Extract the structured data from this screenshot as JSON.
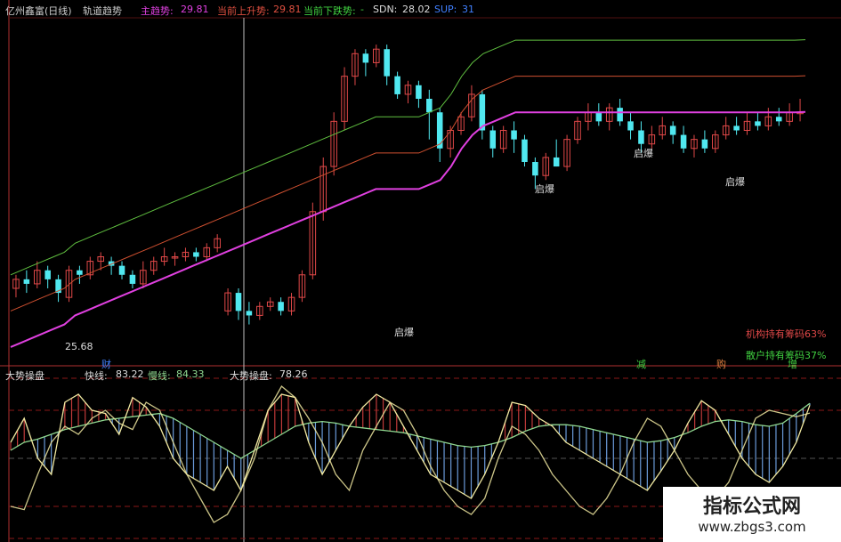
{
  "header": {
    "title": "亿州鑫富(日线)",
    "indicator": "轨道趋势",
    "main_label": "主趋势:",
    "main_value": "29.81",
    "up_label": "当前上升势:",
    "up_value": "29.81",
    "down_label": "当前下跌势:",
    "down_value": "-",
    "sdn_label": "SDN:",
    "sdn_value": "28.02",
    "sup_label": "SUP:",
    "sup_value": "31"
  },
  "upper_panel": {
    "low_marker": "25.68",
    "signal_label": "启爆",
    "inst_chips": "机构持有筹码63%",
    "retail_chips": "散户持有筹码37%",
    "tag_cai": "财",
    "tag_jian": "减",
    "tag_gou": "购",
    "tag_zeng": "增"
  },
  "lower_panel": {
    "title": "大势操盘",
    "fast_label": "快线:",
    "fast_value": "83.22",
    "slow_label": "慢线:",
    "slow_value": "84.33",
    "trend_label": "大势操盘:",
    "trend_value": "78.26"
  },
  "watermark": {
    "line1": "指标公式网",
    "line2": "www.zbgs3.com"
  },
  "colors": {
    "up_candle": "#e04848",
    "down_candle": "#50e8f0",
    "signal_candle": "#40e040",
    "main_trend": "#e040e0",
    "upper_trend": "#d05030",
    "lower_trend": "#60c040",
    "slow_line": "#90d890",
    "fast_line": "#f0e8a0"
  },
  "chart_data": [
    {
      "type": "candlestick",
      "title": "亿州鑫富(日线)",
      "series": [
        {
          "name": "主趋势",
          "color": "#e040e0",
          "values": [
            24.6,
            24.7,
            24.8,
            24.9,
            25.0,
            25.1,
            25.3,
            25.4,
            25.5,
            25.6,
            25.7,
            25.8,
            25.9,
            26.0,
            26.1,
            26.2,
            26.3,
            26.4,
            26.5,
            26.6,
            26.7,
            26.8,
            26.9,
            27.0,
            27.1,
            27.2,
            27.3,
            27.4,
            27.5,
            27.6,
            27.7,
            27.8,
            27.9,
            28.0,
            28.1,
            28.1,
            28.1,
            28.1,
            28.1,
            28.2,
            28.3,
            28.6,
            29.0,
            29.3,
            29.5,
            29.6,
            29.7,
            29.8,
            29.8,
            29.8,
            29.8,
            29.8,
            29.8,
            29.8,
            29.8,
            29.8,
            29.8,
            29.8,
            29.8,
            29.8,
            29.8,
            29.8,
            29.8,
            29.8,
            29.8,
            29.8,
            29.8,
            29.8,
            29.8,
            29.8,
            29.8,
            29.8,
            29.8,
            29.8,
            29.81
          ]
        }
      ],
      "candles": [
        [
          25.9,
          26.1,
          25.7,
          26.2
        ],
        [
          26.1,
          26.0,
          25.8,
          26.3
        ],
        [
          26.0,
          26.3,
          25.9,
          26.5
        ],
        [
          26.3,
          26.1,
          25.9,
          26.4
        ],
        [
          26.1,
          25.8,
          25.6,
          26.2
        ],
        [
          25.7,
          26.3,
          25.6,
          26.4
        ],
        [
          26.3,
          26.2,
          26.0,
          26.4
        ],
        [
          26.2,
          26.5,
          26.1,
          26.6
        ],
        [
          26.5,
          26.6,
          26.3,
          26.7
        ],
        [
          26.5,
          26.4,
          26.2,
          26.6
        ],
        [
          26.4,
          26.2,
          26.1,
          26.5
        ],
        [
          26.2,
          26.0,
          25.9,
          26.3
        ],
        [
          26.0,
          26.3,
          25.9,
          26.5
        ],
        [
          26.3,
          26.5,
          26.2,
          26.6
        ],
        [
          26.5,
          26.6,
          26.4,
          26.8
        ],
        [
          26.6,
          26.6,
          26.4,
          26.7
        ],
        [
          26.6,
          26.7,
          26.5,
          26.8
        ],
        [
          26.7,
          26.6,
          26.5,
          26.8
        ],
        [
          26.6,
          26.8,
          26.5,
          26.9
        ],
        [
          26.8,
          27.0,
          26.7,
          27.1
        ],
        [
          25.4,
          25.8,
          25.3,
          25.9
        ],
        [
          25.8,
          25.4,
          25.2,
          25.9
        ],
        [
          25.4,
          25.3,
          25.1,
          25.6
        ],
        [
          25.3,
          25.5,
          25.2,
          25.6
        ],
        [
          25.5,
          25.6,
          25.4,
          25.7
        ],
        [
          25.6,
          25.4,
          25.3,
          25.7
        ],
        [
          25.4,
          25.7,
          25.3,
          25.8
        ],
        [
          25.7,
          26.2,
          25.6,
          26.3
        ],
        [
          26.2,
          27.6,
          26.1,
          27.8
        ],
        [
          27.6,
          28.6,
          27.4,
          28.8
        ],
        [
          28.6,
          29.6,
          28.4,
          29.8
        ],
        [
          29.6,
          30.6,
          29.4,
          30.8
        ],
        [
          30.6,
          31.1,
          30.4,
          31.2
        ],
        [
          31.1,
          30.9,
          30.6,
          31.2
        ],
        [
          30.9,
          31.2,
          30.8,
          31.3
        ],
        [
          31.2,
          30.6,
          30.4,
          31.3
        ],
        [
          30.6,
          30.2,
          30.1,
          30.7
        ],
        [
          30.2,
          30.4,
          30.0,
          30.5
        ],
        [
          30.4,
          30.1,
          29.9,
          30.5
        ],
        [
          30.1,
          29.8,
          29.2,
          30.3
        ],
        [
          29.8,
          29.0,
          28.7,
          29.9
        ],
        [
          29.0,
          29.4,
          28.8,
          29.5
        ],
        [
          29.4,
          29.7,
          29.3,
          29.8
        ],
        [
          29.7,
          30.2,
          29.6,
          30.4
        ],
        [
          30.2,
          29.4,
          29.2,
          30.3
        ],
        [
          29.4,
          29.0,
          28.8,
          29.5
        ],
        [
          29.0,
          29.4,
          28.9,
          29.5
        ],
        [
          29.4,
          29.2,
          28.9,
          29.6
        ],
        [
          29.2,
          28.7,
          28.6,
          29.3
        ],
        [
          28.7,
          28.4,
          28.1,
          28.8
        ],
        [
          28.4,
          28.8,
          28.3,
          28.9
        ],
        [
          28.8,
          28.6,
          28.6,
          29.2
        ],
        [
          28.6,
          29.2,
          28.5,
          29.3
        ],
        [
          29.2,
          29.6,
          29.1,
          29.7
        ],
        [
          29.6,
          29.8,
          29.4,
          30.0
        ],
        [
          29.8,
          29.6,
          29.5,
          30.0
        ],
        [
          29.6,
          29.9,
          29.4,
          30.0
        ],
        [
          29.9,
          29.6,
          29.5,
          30.1
        ],
        [
          29.6,
          29.4,
          29.2,
          29.8
        ],
        [
          29.4,
          29.1,
          28.9,
          29.6
        ],
        [
          29.1,
          29.3,
          29.0,
          29.5
        ],
        [
          29.3,
          29.5,
          29.2,
          29.7
        ],
        [
          29.5,
          29.3,
          29.1,
          29.6
        ],
        [
          29.3,
          29.0,
          28.9,
          29.5
        ],
        [
          29.0,
          29.2,
          28.8,
          29.3
        ],
        [
          29.2,
          29.0,
          28.9,
          29.4
        ],
        [
          29.0,
          29.3,
          28.9,
          29.4
        ],
        [
          29.3,
          29.5,
          29.2,
          29.7
        ],
        [
          29.5,
          29.4,
          29.3,
          29.7
        ],
        [
          29.4,
          29.6,
          29.3,
          29.8
        ],
        [
          29.6,
          29.5,
          29.4,
          29.8
        ],
        [
          29.5,
          29.7,
          29.4,
          29.9
        ],
        [
          29.7,
          29.6,
          29.5,
          29.9
        ],
        [
          29.6,
          29.8,
          29.5,
          30.0
        ],
        [
          29.8,
          29.8,
          29.6,
          30.1
        ]
      ]
    },
    {
      "type": "line",
      "title": "大势操盘",
      "series": [
        {
          "name": "快线",
          "color": "#f0e8a0",
          "values": [
            60,
            75,
            50,
            40,
            85,
            90,
            80,
            78,
            65,
            88,
            82,
            70,
            50,
            40,
            35,
            30,
            45,
            30,
            55,
            80,
            90,
            88,
            60,
            40,
            55,
            70,
            82,
            90,
            85,
            70,
            55,
            40,
            35,
            30,
            25,
            40,
            60,
            85,
            83,
            75,
            70,
            60,
            55,
            50,
            45,
            40,
            35,
            30,
            42,
            55,
            72,
            86,
            80,
            65,
            50,
            40,
            35,
            45,
            60,
            83.22
          ]
        },
        {
          "name": "慢线",
          "color": "#90d890",
          "values": [
            55,
            60,
            62,
            65,
            68,
            70,
            72,
            74,
            75,
            76,
            77,
            78,
            75,
            70,
            65,
            60,
            55,
            50,
            55,
            60,
            65,
            70,
            72,
            73,
            72,
            70,
            69,
            68,
            67,
            66,
            64,
            62,
            60,
            58,
            57,
            58,
            60,
            63,
            67,
            70,
            71,
            71,
            70,
            68,
            66,
            64,
            62,
            60,
            61,
            63,
            66,
            70,
            73,
            74,
            73,
            71,
            70,
            72,
            78,
            84.33
          ]
        },
        {
          "name": "大势操盘",
          "color": "#f0e8a0",
          "values": [
            20,
            18,
            40,
            60,
            70,
            65,
            75,
            80,
            72,
            68,
            85,
            80,
            60,
            40,
            25,
            10,
            15,
            30,
            50,
            80,
            95,
            88,
            75,
            60,
            40,
            30,
            55,
            70,
            85,
            80,
            65,
            45,
            30,
            20,
            15,
            25,
            50,
            70,
            65,
            55,
            40,
            30,
            20,
            15,
            25,
            40,
            60,
            75,
            70,
            55,
            40,
            30,
            25,
            35,
            55,
            75,
            80,
            78,
            76,
            78.26
          ]
        }
      ]
    }
  ]
}
